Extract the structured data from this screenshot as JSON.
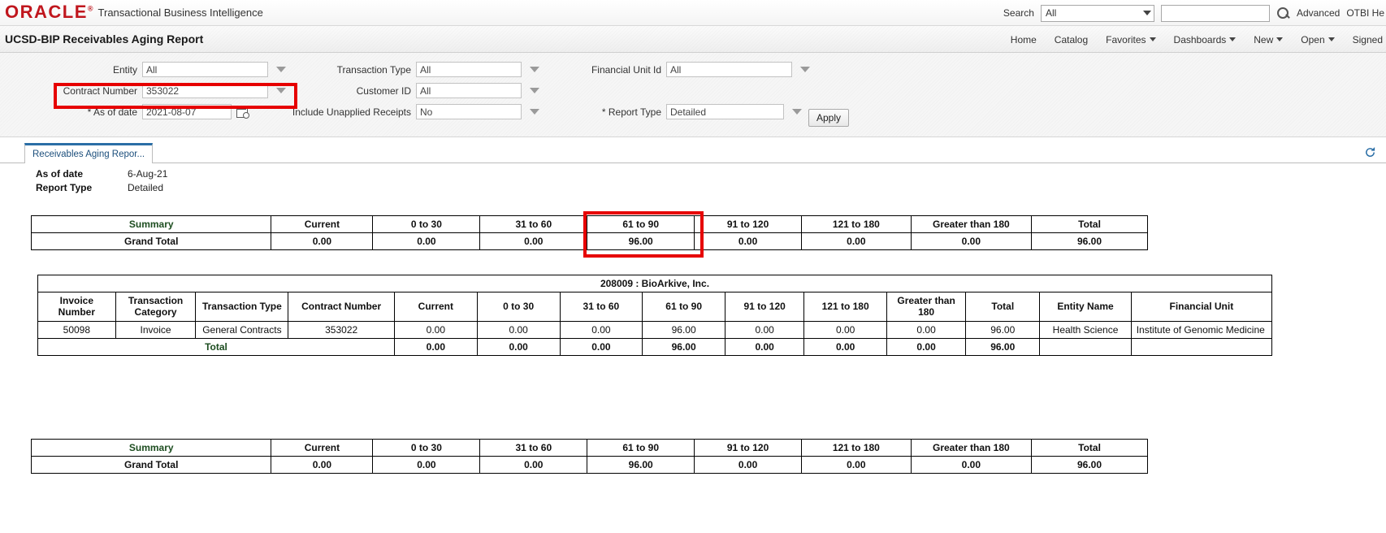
{
  "global_header": {
    "logo": "ORACLE",
    "logo_tm": "®",
    "product": "Transactional Business Intelligence",
    "search_label": "Search",
    "search_scope": "All",
    "search_value": "",
    "search_placeholder": "",
    "search_icon": "search-icon",
    "advanced_link": "Advanced",
    "account_link": "OTBI He"
  },
  "title_bar": {
    "report_title": "UCSD-BIP Receivables Aging Report",
    "nav": [
      {
        "label": "Home",
        "caret": false
      },
      {
        "label": "Catalog",
        "caret": false
      },
      {
        "label": "Favorites",
        "caret": true
      },
      {
        "label": "Dashboards",
        "caret": true
      },
      {
        "label": "New",
        "caret": true
      },
      {
        "label": "Open",
        "caret": true
      },
      {
        "label": "Signed",
        "caret": false
      }
    ]
  },
  "prompts": {
    "entity": {
      "label": "Entity",
      "value": "All"
    },
    "contract_number": {
      "label": "Contract Number",
      "value": "353022"
    },
    "as_of_date": {
      "label": "* As of date",
      "value": "2021-08-07"
    },
    "transaction_type": {
      "label": "Transaction Type",
      "value": "All"
    },
    "customer_id": {
      "label": "Customer ID",
      "value": "All"
    },
    "include_unapplied_receipts": {
      "label": "Include Unapplied Receipts",
      "value": "No"
    },
    "financial_unit_id": {
      "label": "Financial Unit Id",
      "value": "All"
    },
    "report_type": {
      "label": "* Report Type",
      "value": "Detailed"
    },
    "apply_button": "Apply"
  },
  "tab": {
    "label": "Receivables Aging Repor...",
    "refresh_icon": "refresh-icon"
  },
  "report_meta": {
    "as_of_date_label": "As of date",
    "as_of_date_value": "6-Aug-21",
    "report_type_label": "Report Type",
    "report_type_value": "Detailed"
  },
  "summary_top": {
    "headers": [
      "Summary",
      "Current",
      "0 to 30",
      "31 to 60",
      "61 to 90",
      "91 to 120",
      "121 to 180",
      "Greater than 180",
      "Total"
    ],
    "rows": [
      [
        "Grand Total",
        "0.00",
        "0.00",
        "0.00",
        "96.00",
        "0.00",
        "0.00",
        "0.00",
        "96.00"
      ]
    ],
    "highlighted_column": "61 to 90"
  },
  "detail": {
    "group_title": "208009 : BioArkive, Inc.",
    "headers": [
      "Invoice Number",
      "Transaction Category",
      "Transaction Type",
      "Contract Number",
      "Current",
      "0 to 30",
      "31 to 60",
      "61 to 90",
      "91 to 120",
      "121 to 180",
      "Greater than 180",
      "Total",
      "Entity Name",
      "Financial Unit"
    ],
    "rows": [
      [
        "50098",
        "Invoice",
        "General Contracts",
        "353022",
        "0.00",
        "0.00",
        "0.00",
        "96.00",
        "0.00",
        "0.00",
        "0.00",
        "96.00",
        "Health Science",
        "Institute of Genomic Medicine"
      ]
    ],
    "total_label": "Total",
    "total_values": [
      "0.00",
      "0.00",
      "0.00",
      "96.00",
      "0.00",
      "0.00",
      "0.00",
      "96.00"
    ]
  },
  "summary_bottom": {
    "headers": [
      "Summary",
      "Current",
      "0 to 30",
      "31 to 60",
      "61 to 90",
      "91 to 120",
      "121 to 180",
      "Greater than 180",
      "Total"
    ],
    "rows": [
      [
        "Grand Total",
        "0.00",
        "0.00",
        "0.00",
        "96.00",
        "0.00",
        "0.00",
        "0.00",
        "96.00"
      ]
    ]
  },
  "annotations": {
    "highlight_color": "#e60000",
    "boxes": [
      "contract-number-field",
      "summary-61-to-90-column"
    ]
  }
}
